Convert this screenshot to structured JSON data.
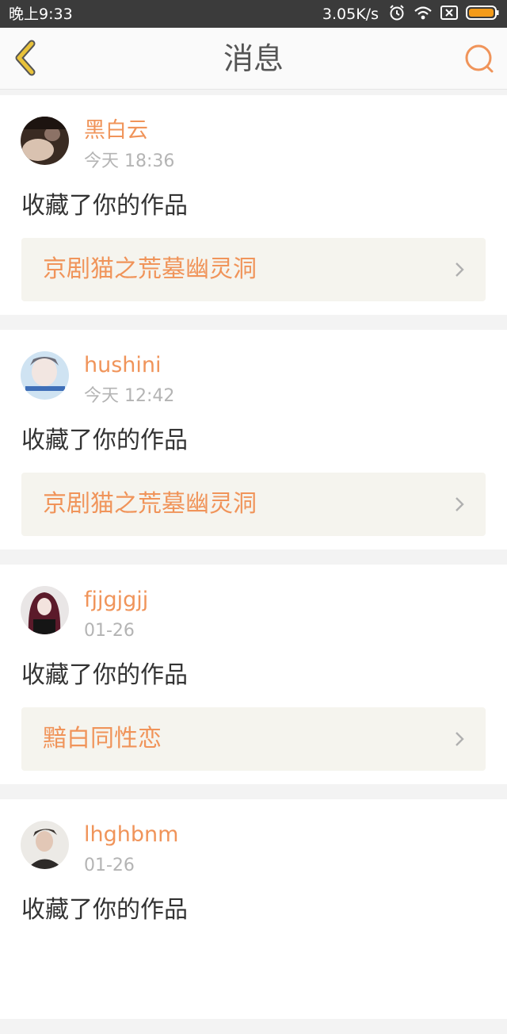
{
  "status_bar": {
    "time": "晚上9:33",
    "network_speed": "3.05K/s",
    "icons": [
      "alarm-icon",
      "wifi-icon",
      "sim-x-icon",
      "battery-icon"
    ]
  },
  "nav": {
    "title": "消息",
    "back_icon": "chevron-left-icon",
    "search_icon": "search-icon"
  },
  "colors": {
    "accent": "#f0945a",
    "back": "#e8c23a",
    "card_inner": "#f5f4ee"
  },
  "messages": [
    {
      "username": "黑白云",
      "time": "今天 18:36",
      "action": "收藏了你的作品",
      "work_title": "京剧猫之荒墓幽灵洞"
    },
    {
      "username": "hushini",
      "time": "今天 12:42",
      "action": "收藏了你的作品",
      "work_title": "京剧猫之荒墓幽灵洞"
    },
    {
      "username": "fjjgjgjj",
      "time": "01-26",
      "action": "收藏了你的作品",
      "work_title": "黯白同性恋"
    },
    {
      "username": "lhghbnm",
      "time": "01-26",
      "action": "收藏了你的作品",
      "work_title": ""
    }
  ]
}
